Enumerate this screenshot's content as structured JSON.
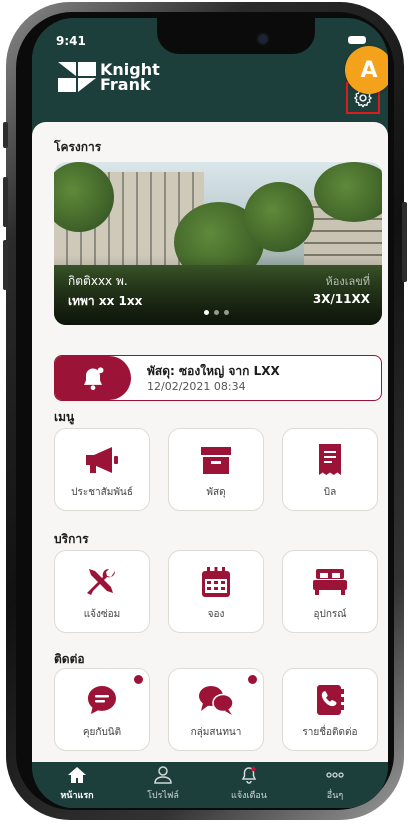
{
  "status": {
    "time": "9:41"
  },
  "brand": {
    "line1": "Knight",
    "line2": "Frank"
  },
  "annotation": {
    "badge": "A"
  },
  "project": {
    "section_title": "โครงการ",
    "name": "กิตติxxx พ.",
    "location": "เทพา xx 1xx",
    "room_label": "ห้องเลขที่",
    "room_number": "3X/11XX",
    "slide_count": 3,
    "active_slide": 0
  },
  "notice": {
    "title": "พัสดุ: ซองใหญ่ จาก LXX",
    "time": "12/02/2021 08:34"
  },
  "menu": {
    "title": "เมนู",
    "items": [
      {
        "label": "ประชาสัมพันธ์",
        "icon": "megaphone-icon"
      },
      {
        "label": "พัสดุ",
        "icon": "box-icon"
      },
      {
        "label": "บิล",
        "icon": "bill-icon"
      }
    ]
  },
  "services": {
    "title": "บริการ",
    "items": [
      {
        "label": "แจ้งซ่อม",
        "icon": "tools-icon"
      },
      {
        "label": "จอง",
        "icon": "calendar-icon"
      },
      {
        "label": "อุปกรณ์",
        "icon": "bed-icon"
      }
    ]
  },
  "contact": {
    "title": "ติดต่อ",
    "items": [
      {
        "label": "คุยกับนิติ",
        "icon": "chat-icon",
        "unread": true
      },
      {
        "label": "กลุ่มสนทนา",
        "icon": "group-chat-icon",
        "unread": true
      },
      {
        "label": "รายชื่อติดต่อ",
        "icon": "contact-book-icon",
        "unread": false
      }
    ]
  },
  "bottom_nav": [
    {
      "label": "หน้าแรก",
      "icon": "home-icon",
      "active": true
    },
    {
      "label": "โปรไฟล์",
      "icon": "profile-icon",
      "active": false
    },
    {
      "label": "แจ้งเตือน",
      "icon": "bell-icon",
      "active": false
    },
    {
      "label": "อื่นๆ",
      "icon": "more-icon",
      "active": false
    }
  ],
  "colors": {
    "brand_dark": "#1d3f3c",
    "accent": "#9b1437",
    "highlight": "#f4a21c"
  }
}
